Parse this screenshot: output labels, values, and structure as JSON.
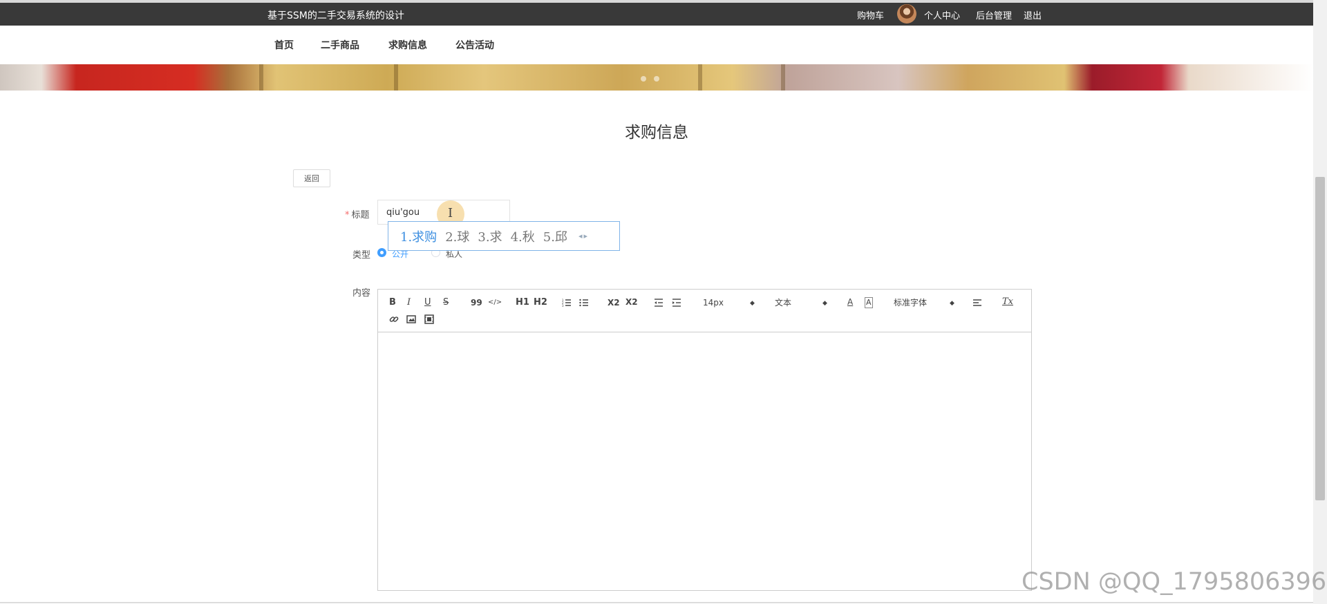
{
  "topbar": {
    "site_title": "基于SSM的二手交易系统的设计",
    "cart": "购物车",
    "profile": "个人中心",
    "admin": "后台管理",
    "logout": "退出"
  },
  "nav": [
    "首页",
    "二手商品",
    "求购信息",
    "公告活动"
  ],
  "page": {
    "title": "求购信息",
    "back_label": "返回"
  },
  "form": {
    "title_label": "标题",
    "title_value": "qiu'gou",
    "type_label": "类型",
    "type_options": [
      "公开",
      "私人"
    ],
    "type_selected": "公开",
    "content_label": "内容"
  },
  "ime": {
    "candidates": [
      "1.求购",
      "2.球",
      "3.求",
      "4.秋",
      "5.邱"
    ],
    "arrows": "◂▸"
  },
  "editor_toolbar": {
    "bold": "B",
    "italic": "I",
    "underline": "U",
    "strike": "S",
    "blockquote": "99",
    "code": "</>",
    "h1": "H1",
    "h2": "H2",
    "subscript": "X2",
    "superscript": "X2",
    "font_size": "14px",
    "header_select": "文本",
    "font_family": "标准字体",
    "clean": "Tx"
  },
  "watermark": "CSDN @QQ_1795806396",
  "colors": {
    "topbar_bg": "#393939",
    "accent": "#409eff",
    "ime_border": "#7fb3e8"
  }
}
